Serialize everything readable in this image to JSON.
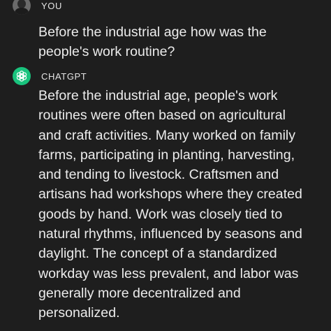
{
  "user_message": {
    "role_label": "YOU",
    "line_1": "Before the industrial age how was the",
    "line_2": "people's work routine?"
  },
  "assistant_message": {
    "role_label": "CHATGPT",
    "lines": [
      "Before the industrial age, people's work",
      "routines were often based on agricultural",
      "and craft activities. Many worked on family",
      "farms, participating in planting, harvesting,",
      "and tending to livestock. Craftsmen and",
      "artisans had workshops where they created",
      "goods by hand. Work was closely tied to",
      "natural rhythms, influenced by seasons and",
      "daylight. The concept of a standardized",
      "workday was less prevalent, and labor was",
      "generally more decentralized and",
      "personalized."
    ]
  },
  "icons": {
    "user_avatar": "user-avatar-icon",
    "assistant_avatar": "openai-logo-icon"
  },
  "colors": {
    "background": "#1e1e1e",
    "text": "#ececec",
    "assistant_avatar_bg": "#19c37d"
  }
}
